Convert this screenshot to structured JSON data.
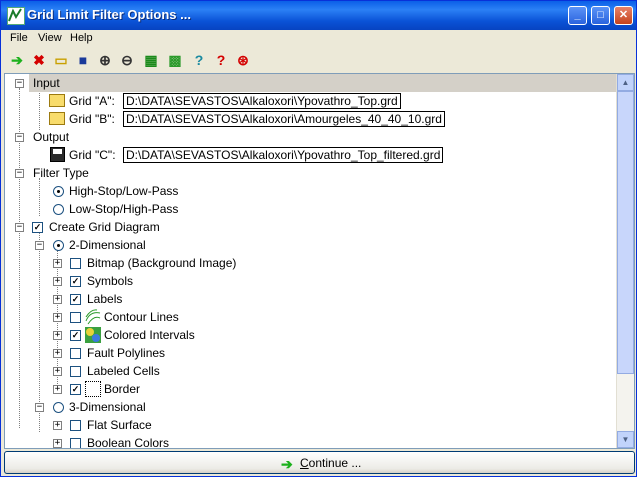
{
  "window": {
    "title": "Grid Limit Filter Options ..."
  },
  "menu": {
    "file": "File",
    "view": "View",
    "help": "Help"
  },
  "toolbar": {
    "icons": [
      "continue-icon",
      "cancel-icon",
      "open-icon",
      "save-icon",
      "zoom-in-icon",
      "zoom-out-icon",
      "table-icon",
      "grid-icon",
      "help-icon",
      "context-help-icon",
      "target-icon"
    ]
  },
  "tree": {
    "input": "Input",
    "grid_a_label": "Grid \"A\":",
    "grid_a_path": "D:\\DATA\\SEVASTOS\\Alkaloxori\\Ypovathro_Top.grd",
    "grid_b_label": "Grid \"B\":",
    "grid_b_path": "D:\\DATA\\SEVASTOS\\Alkaloxori\\Amourgeles_40_40_10.grd",
    "output": "Output",
    "grid_c_label": "Grid \"C\":",
    "grid_c_path": "D:\\DATA\\SEVASTOS\\Alkaloxori\\Ypovathro_Top_filtered.grd",
    "filter_type": "Filter Type",
    "high_stop": "High-Stop/Low-Pass",
    "low_stop": "Low-Stop/High-Pass",
    "create_grid_diagram": "Create Grid Diagram",
    "two_d": "2-Dimensional",
    "bitmap": "Bitmap (Background Image)",
    "symbols": "Symbols",
    "labels": "Labels",
    "contour_lines": "Contour Lines",
    "colored_intervals": "Colored Intervals",
    "fault_polylines": "Fault Polylines",
    "labeled_cells": "Labeled Cells",
    "border": "Border",
    "three_d": "3-Dimensional",
    "flat_surface": "Flat Surface",
    "boolean_colors": "Boolean Colors"
  },
  "footer": {
    "continue_prefix": "",
    "continue_underline": "C",
    "continue_rest": "ontinue ..."
  }
}
